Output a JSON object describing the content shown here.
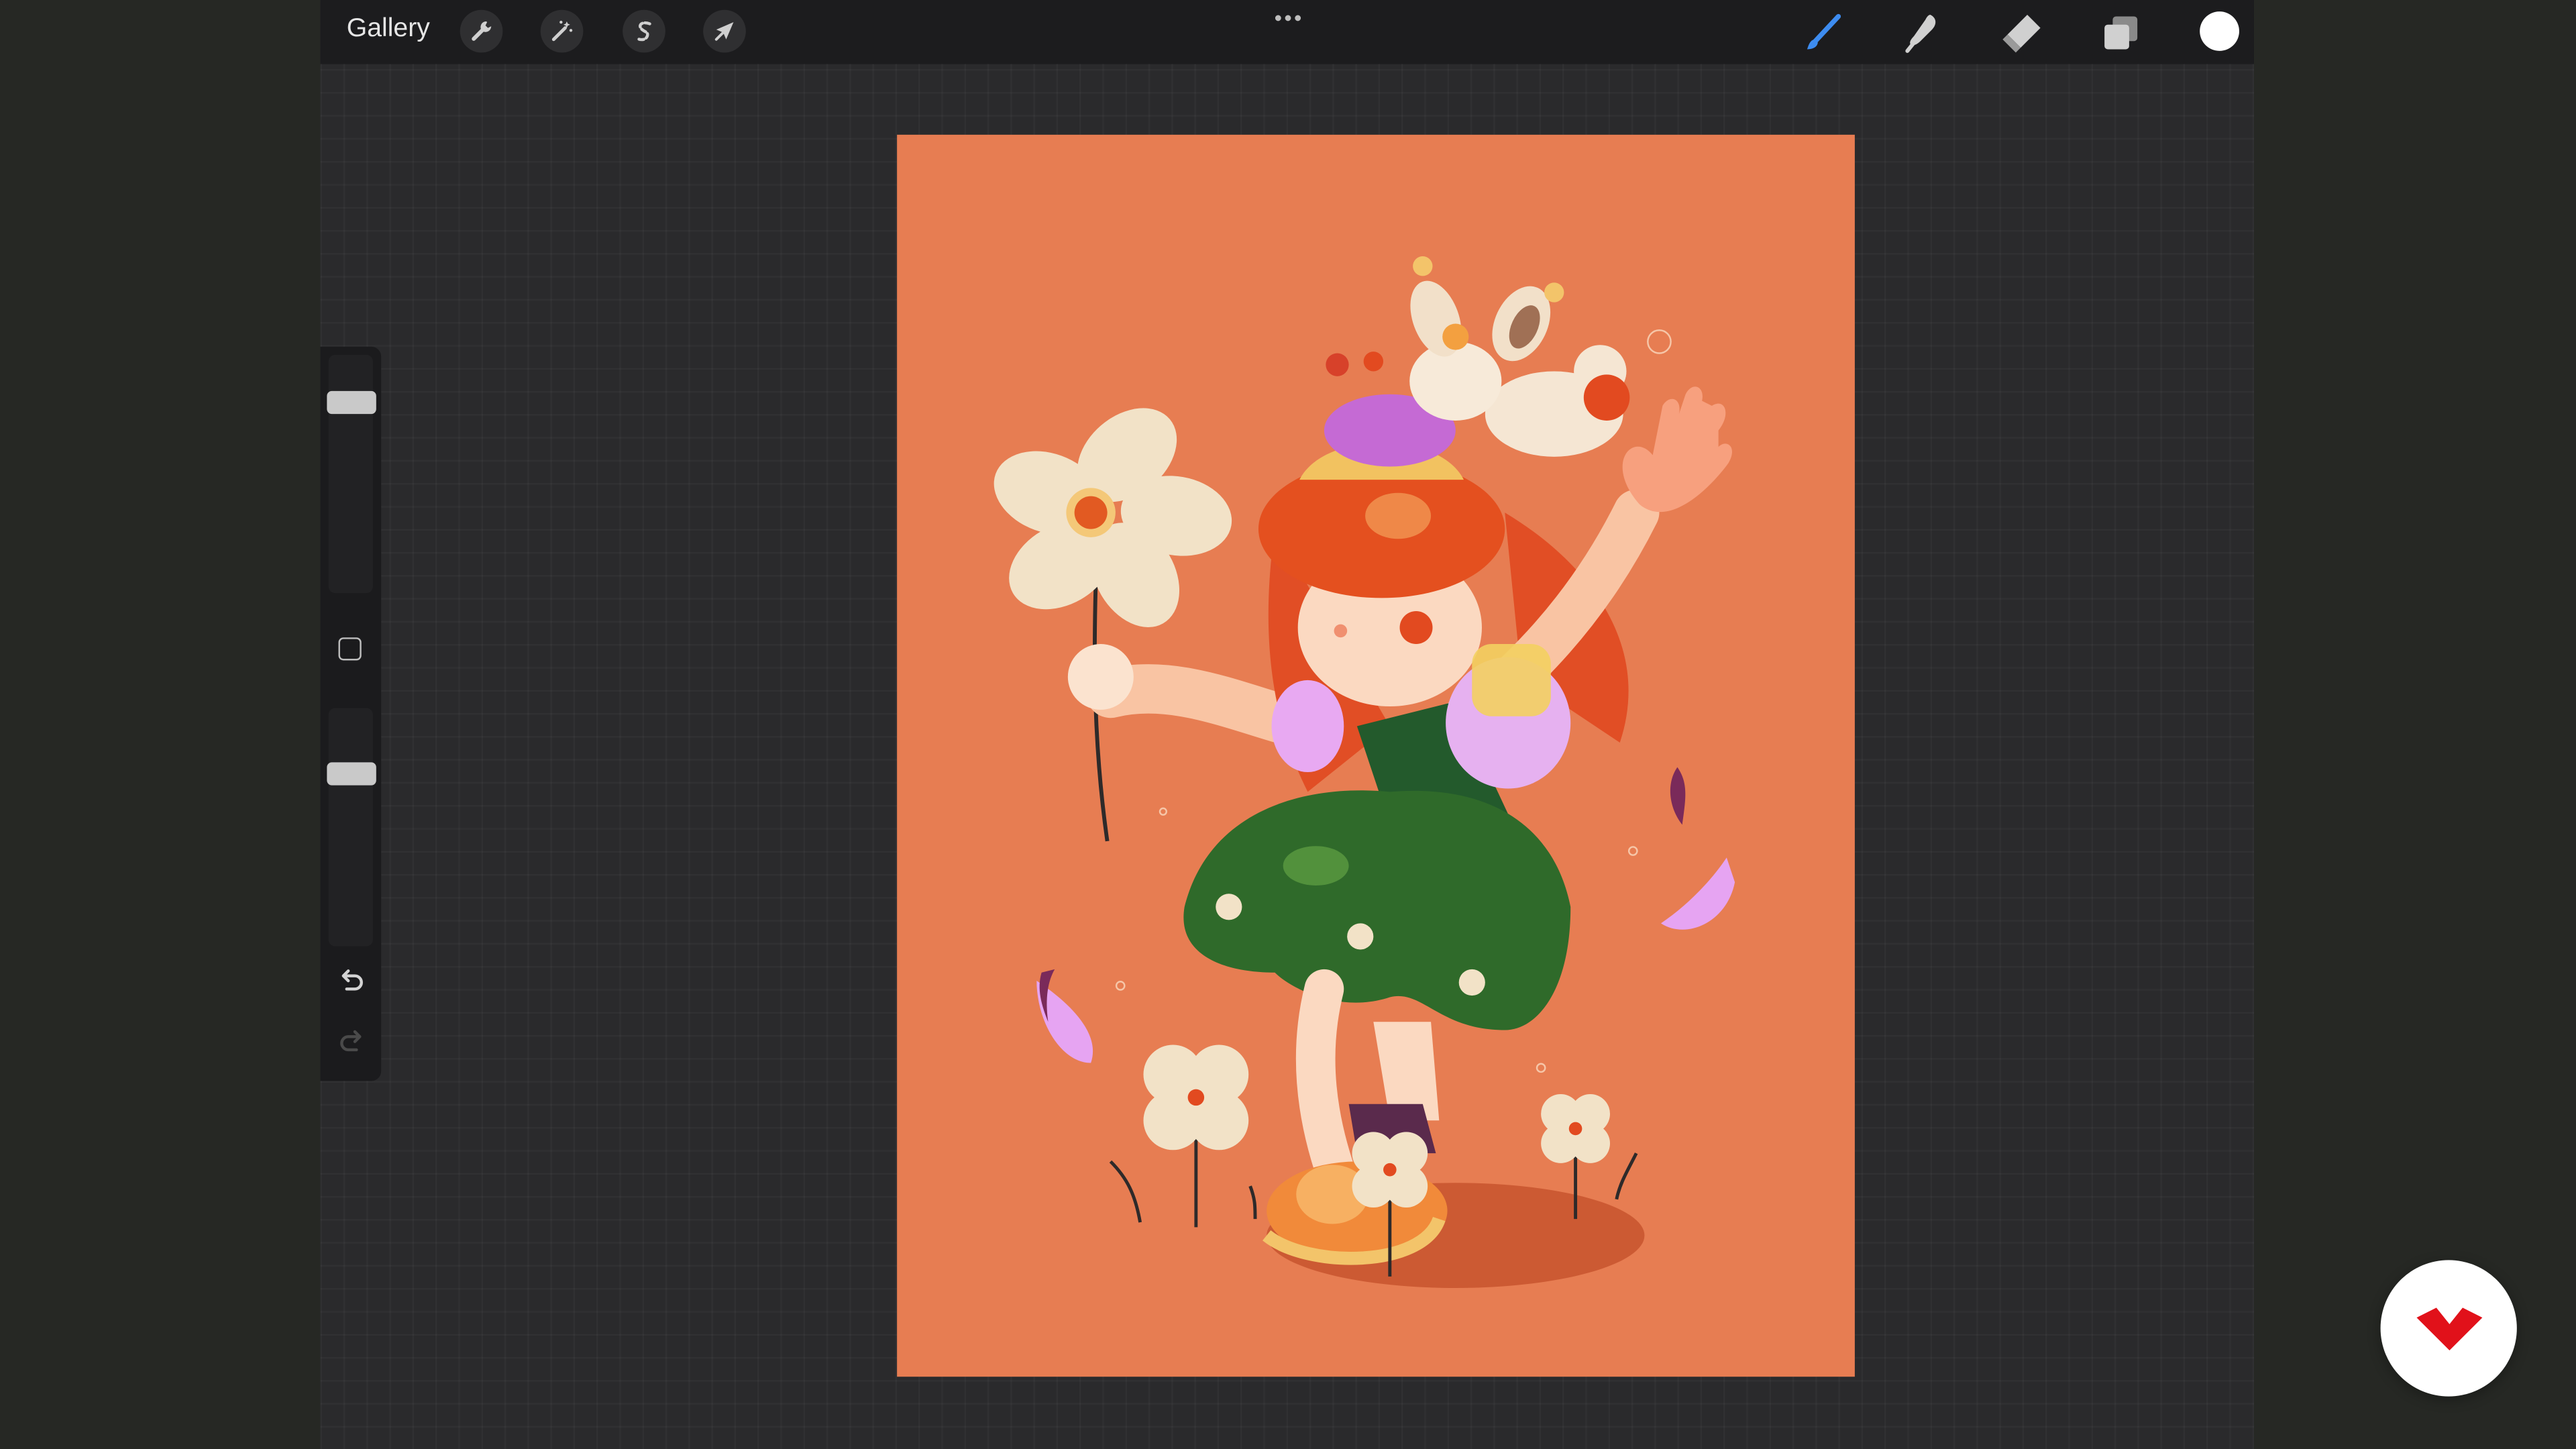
{
  "topbar": {
    "gallery_label": "Gallery",
    "left_tools": [
      {
        "icon": "wrench-icon",
        "name": "actions"
      },
      {
        "icon": "magic-wand-icon",
        "name": "adjustments"
      },
      {
        "icon": "selection-s-icon",
        "name": "selection"
      },
      {
        "icon": "arrow-cursor-icon",
        "name": "transform"
      }
    ],
    "more_icon": "more-dots-icon",
    "right_tools": [
      {
        "icon": "brush-icon",
        "name": "paint",
        "active": true
      },
      {
        "icon": "smudge-icon",
        "name": "smudge"
      },
      {
        "icon": "eraser-icon",
        "name": "erase"
      },
      {
        "icon": "layers-icon",
        "name": "layers"
      }
    ],
    "current_color": "#ffffff",
    "active_color": "#3d8cf0"
  },
  "sidebar": {
    "brush_size": 0.83,
    "brush_opacity": 0.75,
    "undo_icon": "undo-icon",
    "redo_icon": "redo-icon",
    "modify_icon": "modify-square-icon"
  },
  "canvas": {
    "background": "#e77d52",
    "artwork": "illustration-girl-with-flower-and-bunny"
  },
  "badge": {
    "icon": "red-logo-icon",
    "color": "#e1111a"
  }
}
